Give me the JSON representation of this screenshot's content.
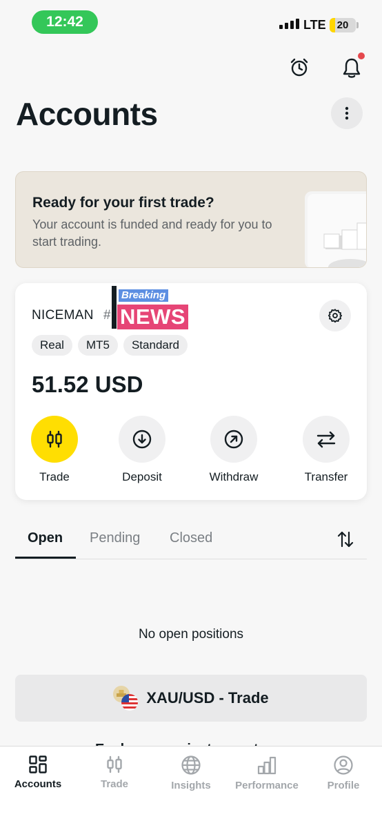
{
  "status_bar": {
    "time": "12:42",
    "network": "LTE",
    "battery": "20",
    "battery_level": 0.2
  },
  "header": {
    "title": "Accounts"
  },
  "banner": {
    "title": "Ready for your first trade?",
    "text": "Your account is funded and ready for you to start trading."
  },
  "account": {
    "name": "NICEMAN",
    "hash": "#",
    "overlay_top": "Breaking",
    "overlay_main": "NEWS",
    "tags": [
      "Real",
      "MT5",
      "Standard"
    ],
    "balance": "51.52 USD",
    "actions": [
      {
        "label": "Trade",
        "icon": "candlestick-icon"
      },
      {
        "label": "Deposit",
        "icon": "arrow-down-circle-icon"
      },
      {
        "label": "Withdraw",
        "icon": "arrow-up-right-circle-icon"
      },
      {
        "label": "Transfer",
        "icon": "transfer-arrows-icon"
      }
    ]
  },
  "positions_tabs": {
    "open": "Open",
    "pending": "Pending",
    "closed": "Closed"
  },
  "empty_message": "No open positions",
  "trade_cta": {
    "label": "XAU/USD - Trade"
  },
  "peek_text": "Explore more instruments",
  "bottom_nav": {
    "accounts": "Accounts",
    "trade": "Trade",
    "insights": "Insights",
    "performance": "Performance",
    "profile": "Profile"
  },
  "colors": {
    "accent": "#ffde02",
    "text": "#141d22",
    "notification": "#e5484d",
    "status_pill": "#34c759"
  }
}
